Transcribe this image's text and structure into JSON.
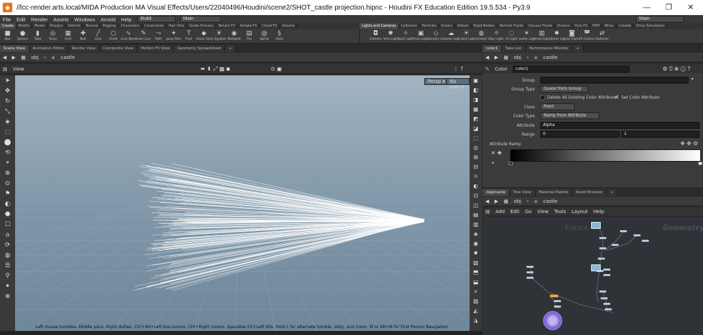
{
  "titlebar": {
    "title": "//lcc-render.arts.local/MIDA Production MA Visual Effects/Users/22040496/Houdini/scene2/SHOT_castle projection.hipnc - Houdini FX Education Edition 19.5.534 - Py3.9",
    "minimize": "—",
    "maximize": "❐",
    "close": "✕"
  },
  "menubar": {
    "items": [
      "File",
      "Edit",
      "Render",
      "Assets",
      "Windows",
      "Arnold",
      "Help"
    ],
    "desktop": "Build",
    "context": "Main",
    "right_context": "Main"
  },
  "shelf_tabs_left": [
    "Create",
    "Modify",
    "Model",
    "Polygon",
    "Deform",
    "Texture",
    "Rigging",
    "Characters",
    "Constraints",
    "Hair Utils",
    "Guide Process",
    "Terrain FX",
    "Simple FX",
    "Cloud FX",
    "Volume"
  ],
  "shelf_tabs_right": [
    "Lights and Cameras",
    "Collisions",
    "Particles",
    "Grains",
    "Vellum",
    "Rigid Bodies",
    "Particle Fluids",
    "Viscous Fluids",
    "Oceans",
    "Pyro FX",
    "FEM",
    "Wires",
    "Crowds",
    "Drive Simulation"
  ],
  "shelf_tools_left": [
    {
      "label": "Box",
      "icon": "■"
    },
    {
      "label": "Sphere",
      "icon": "●"
    },
    {
      "label": "Tube",
      "icon": "▮"
    },
    {
      "label": "Torus",
      "icon": "◎"
    },
    {
      "label": "Grid",
      "icon": "▦"
    },
    {
      "label": "Null",
      "icon": "✚"
    },
    {
      "label": "Line",
      "icon": "╱"
    },
    {
      "label": "Circle",
      "icon": "○"
    },
    {
      "label": "Curve Bezier",
      "icon": "∿"
    },
    {
      "label": "Draw Curve",
      "icon": "✎"
    },
    {
      "label": "Path",
      "icon": "⤳"
    },
    {
      "label": "Spray Paint",
      "icon": "✦"
    },
    {
      "label": "Font",
      "icon": "T"
    },
    {
      "label": "Platonic Solids",
      "icon": "◆"
    },
    {
      "label": "L-System",
      "icon": "¥"
    },
    {
      "label": "Metaball",
      "icon": "◉"
    },
    {
      "label": "File",
      "icon": "▤"
    },
    {
      "label": "Spiral",
      "icon": "@"
    },
    {
      "label": "Helix",
      "icon": "§"
    }
  ],
  "shelf_tools_right": [
    {
      "label": "Camera",
      "icon": "◘"
    },
    {
      "label": "Point Light",
      "icon": "✺"
    },
    {
      "label": "Spot Light",
      "icon": "✧"
    },
    {
      "label": "Area Light",
      "icon": "▣"
    },
    {
      "label": "Geometry Light",
      "icon": "◇"
    },
    {
      "label": "Volume Light",
      "icon": "☁"
    },
    {
      "label": "Distant Light",
      "icon": "☀"
    },
    {
      "label": "Environment Light",
      "icon": "◍"
    },
    {
      "label": "Sky Light",
      "icon": "☼"
    },
    {
      "label": "GI Light",
      "icon": "◌"
    },
    {
      "label": "Caustic Light",
      "icon": "✶"
    },
    {
      "label": "Portal Light",
      "icon": "▥"
    },
    {
      "label": "Ambient Light",
      "icon": "✹"
    },
    {
      "label": "Stereo Camera",
      "icon": "◙"
    },
    {
      "label": "VR Camera",
      "icon": "◚"
    },
    {
      "label": "Switcher",
      "icon": "⇄"
    }
  ],
  "viewer_tabs": [
    "Scene View",
    "Animation Editor",
    "Render View",
    "Composite View",
    "Motion FX View",
    "Geometry Spreadsheet"
  ],
  "param_tabs": [
    "color1",
    "Take List",
    "Performance Monitor"
  ],
  "net_tabs": [
    "/obj/castle",
    "Tree View",
    "Material Palette",
    "Asset Browser"
  ],
  "path": {
    "level1": "obj",
    "level2": "castle"
  },
  "viewport": {
    "label": "View",
    "persp": "Persp ▾",
    "cam": "No cam ▾",
    "status": "Left mouse tumbles. Middle pans. Right dollies. Ctrl+Alt+Left box-zooms. Ctrl+Right zooms. Spacebar-Ctrl-Left tilts. Hold L for alternate tumble, dolly, and zoom.    M or Alt+M for First Person Navigation."
  },
  "params": {
    "node_type": "Color",
    "node_name": "color1",
    "group_label": "Group",
    "group_value": "",
    "group_type_label": "Group Type",
    "group_type_value": "Guess from Group",
    "delete_label": "Delete All Existing Color Attributes",
    "set_color_label": "Set Color Attribute",
    "class_label": "Class",
    "class_value": "Point",
    "color_type_label": "Color Type",
    "color_type_value": "Ramp from Attribute",
    "attribute_label": "Attribute",
    "attribute_value": "Alpha",
    "range_label": "Range",
    "range_min": "0",
    "range_max": "1",
    "ramp_label": "Attribute Ramp"
  },
  "net_menu": [
    "Add",
    "Edit",
    "Go",
    "View",
    "Tools",
    "Layout",
    "Help"
  ],
  "net_watermark_left": "Educa",
  "net_watermark_right": "Geometry"
}
